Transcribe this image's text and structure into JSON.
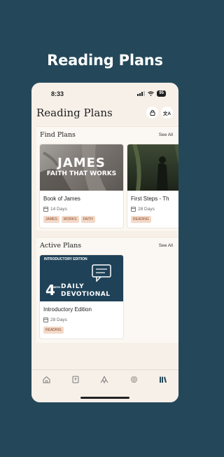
{
  "headline": "Reading Plans",
  "status": {
    "time": "8:33",
    "battery": "95"
  },
  "header": {
    "title": "Reading Plans",
    "lock_icon": "lock-icon",
    "translate_icon": "translate-icon",
    "translate_glyph": "文A"
  },
  "find": {
    "title": "Find Plans",
    "see_all": "See All",
    "cards": [
      {
        "img_title": "JAMES",
        "img_subtitle": "FAITH THAT WORKS",
        "title": "Book of James",
        "days": "14 Days",
        "tags": [
          "JAMES",
          "WORKS",
          "FAITH"
        ]
      },
      {
        "title": "First Steps - Th",
        "days": "28 Days",
        "tags": [
          "READING"
        ]
      }
    ]
  },
  "active": {
    "title": "Active Plans",
    "see_all": "See All",
    "cards": [
      {
        "img_top": "INTRODUCTORY EDITION",
        "img_num": "4",
        "img_weeks": "WEEK",
        "img_line1": "DAILY",
        "img_line2": "DEVOTIONAL",
        "title": "Introductory Edition",
        "days": "28 Days",
        "tags": [
          "READING"
        ]
      }
    ]
  },
  "tabs": [
    "home-icon",
    "bible-icon",
    "prayer-icon",
    "brain-icon",
    "library-icon"
  ],
  "colors": {
    "background": "#24485a",
    "active_tab": "#24485a",
    "tag_bg": "#f3d9c8"
  }
}
